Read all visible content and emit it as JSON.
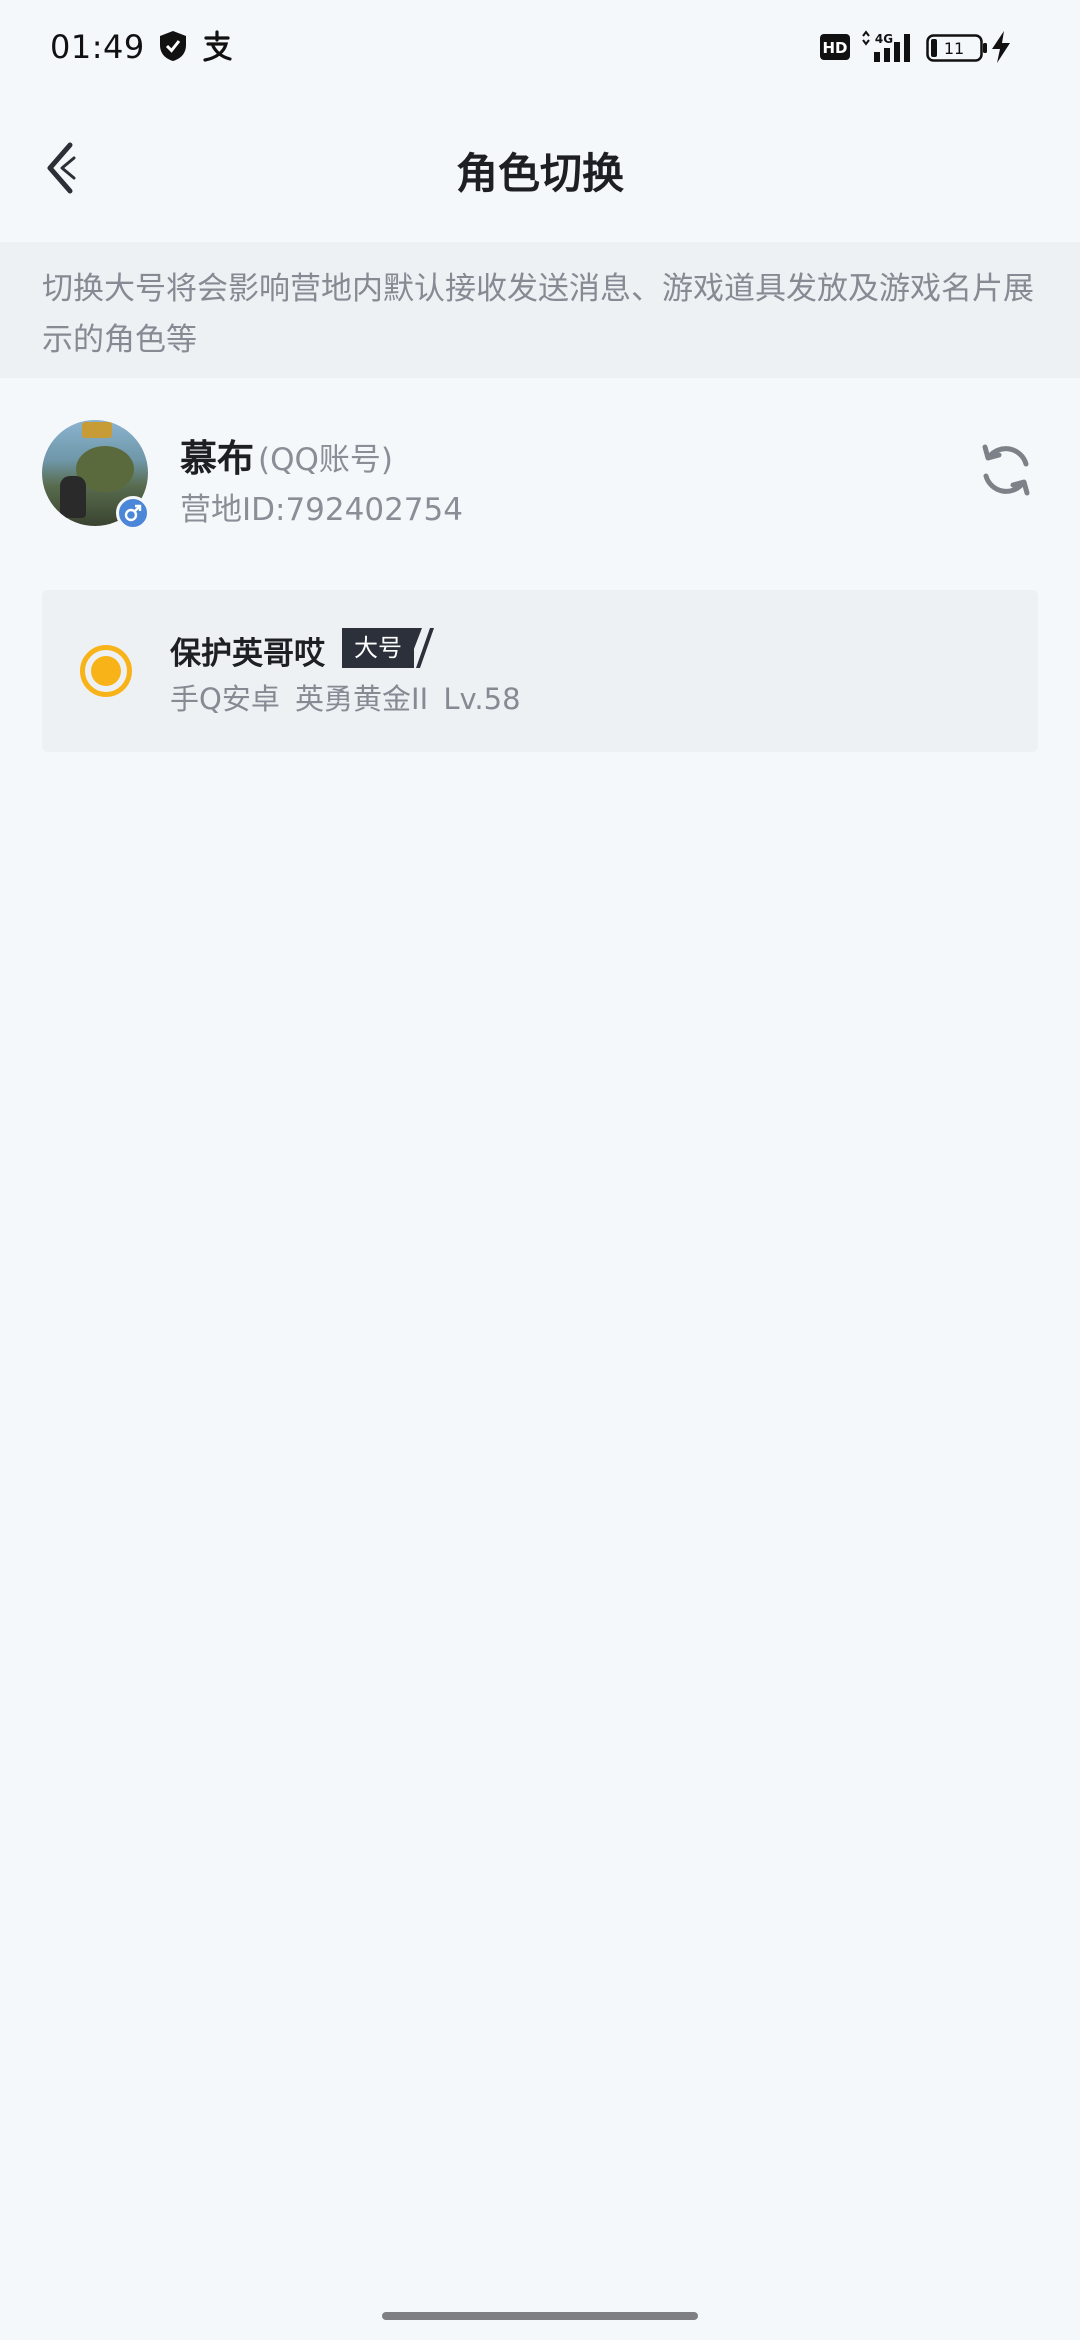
{
  "status_bar": {
    "time": "01:49",
    "network": "4G",
    "battery": "11",
    "icons": [
      "shield-icon",
      "alipay-icon",
      "hd-icon",
      "signal-icon",
      "battery-icon",
      "charging-icon"
    ]
  },
  "header": {
    "title": "角色切换",
    "back_icon": "chevron-left-icon"
  },
  "notice": {
    "text": "切换大号将会影响营地内默认接收发送消息、游戏道具发放及游戏名片展示的角色等"
  },
  "account": {
    "name": "慕布",
    "type": "(QQ账号)",
    "camp_id": "营地ID:792402754",
    "gender_icon": "male-icon",
    "refresh_icon": "refresh-icon"
  },
  "roles": [
    {
      "name": "保护英哥哎",
      "tag": "大号",
      "info": "手Q安卓  英勇黄金II  Lv.58",
      "selected": true
    }
  ],
  "colors": {
    "background": "#f5f8fb",
    "notice_bg": "#eef1f4",
    "accent": "#f8b318",
    "tag_bg": "#2b303a",
    "gender_badge": "#4b86d8"
  }
}
